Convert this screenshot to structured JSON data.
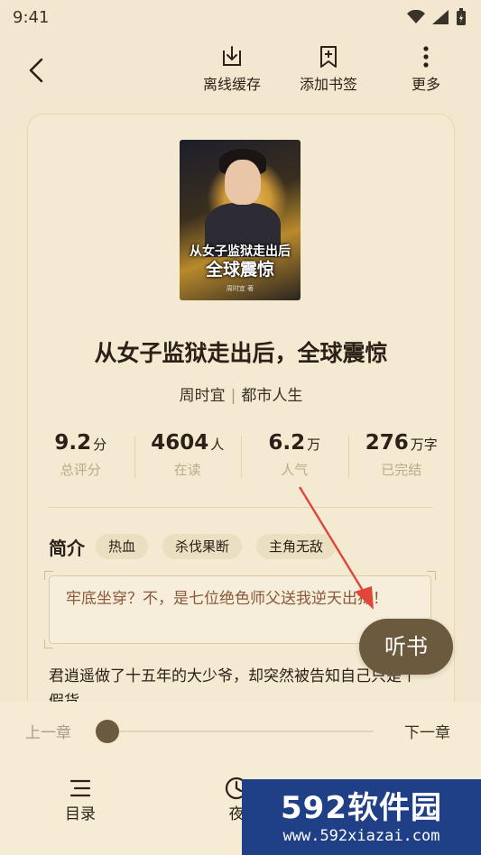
{
  "status_bar": {
    "time": "9:41"
  },
  "top_bar": {
    "offline_cache_label": "离线缓存",
    "add_bookmark_label": "添加书签",
    "more_label": "更多"
  },
  "book": {
    "cover_title_line1": "从女子监狱走出后",
    "cover_title_line2": "全球震惊",
    "cover_author": "周时宜 著",
    "title": "从女子监狱走出后，全球震惊",
    "author": "周时宜",
    "category": "都市人生"
  },
  "stats": [
    {
      "value": "9.2",
      "unit": "分",
      "label": "总评分"
    },
    {
      "value": "4604",
      "unit": "人",
      "label": "在读"
    },
    {
      "value": "6.2",
      "unit": "万",
      "label": "人气"
    },
    {
      "value": "276",
      "unit": "万字",
      "label": "已完结"
    }
  ],
  "intro": {
    "heading": "简介",
    "tags": [
      "热血",
      "杀伐果断",
      "主角无敌"
    ],
    "quote": "牢底坐穿？不，是七位绝色师父送我逆天出狱！",
    "description": "君逍遥做了十五年的大少爷，却突然被告知自己只是个假货..."
  },
  "listen_button": {
    "label": "听书"
  },
  "chapter_nav": {
    "prev_label": "上一章",
    "next_label": "下一章",
    "progress": 0.0
  },
  "bottom_nav": {
    "toc_label": "目录",
    "night_label": "夜"
  },
  "watermark": {
    "main": "592软件园",
    "url": "www.592xiazai.com"
  },
  "colors": {
    "background": "#f3e8cf",
    "accent_brown": "#6b5a3d",
    "quote_text": "#8a5a3a",
    "arrow_red": "#e0473a",
    "watermark_blue": "#1f3f86"
  }
}
